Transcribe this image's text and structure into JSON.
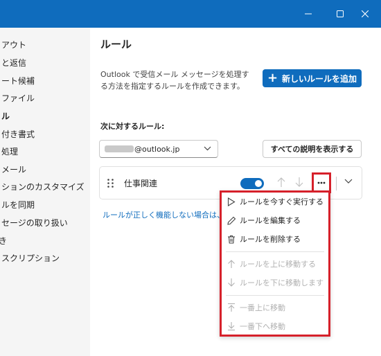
{
  "sidebar": {
    "items": [
      {
        "label": "アウト",
        "active": false
      },
      {
        "label": "と返信",
        "active": false
      },
      {
        "label": "ート候補",
        "active": false
      },
      {
        "label": "ファイル",
        "active": false
      },
      {
        "label": "ル",
        "active": true
      },
      {
        "label": "付き書式",
        "active": false
      },
      {
        "label": "処理",
        "active": false
      },
      {
        "label": "メール",
        "active": false
      },
      {
        "label": "ションのカスタマイズ",
        "active": false
      },
      {
        "label": "ルを同期",
        "active": false
      },
      {
        "label": "セージの取り扱い",
        "active": false
      },
      {
        "label": "き",
        "active": false
      },
      {
        "label": "スクリプション",
        "active": false
      }
    ]
  },
  "main": {
    "title": "ルール",
    "description": "Outlook で受信メール メッセージを処理する方法を指定するルールを作成できます。",
    "add_rule_label": "新しいルールを追加",
    "rules_for_label": "次に対するルール:",
    "account_suffix": "@outlook.jp",
    "show_all_desc_label": "すべての説明を表示する",
    "help_text": "ルールが正しく機能しない場合は、診"
  },
  "rule": {
    "name": "仕事関連",
    "enabled": true
  },
  "menu": {
    "items": [
      {
        "label": "ルールを今すぐ実行する",
        "icon": "play-icon",
        "disabled": false
      },
      {
        "label": "ルールを編集する",
        "icon": "pencil-icon",
        "disabled": false
      },
      {
        "label": "ルールを削除する",
        "icon": "trash-icon",
        "disabled": false
      },
      {
        "label": "ルールを上に移動する",
        "icon": "arrow-up-icon",
        "disabled": true
      },
      {
        "label": "ルールを下に移動します",
        "icon": "arrow-down-icon",
        "disabled": true
      },
      {
        "label": "一番上に移動",
        "icon": "arrow-to-top-icon",
        "disabled": true
      },
      {
        "label": "一番下へ移動",
        "icon": "arrow-to-bottom-icon",
        "disabled": true
      }
    ]
  },
  "colors": {
    "accent": "#0f6cbd",
    "highlight": "#d6202a",
    "sidebar_bg": "#f5f5f5",
    "disabled_text": "#b0b0b0"
  }
}
